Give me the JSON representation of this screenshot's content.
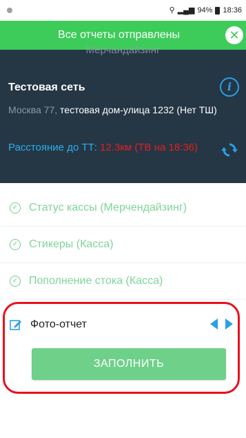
{
  "status_bar": {
    "battery": "94%",
    "time": "18:36"
  },
  "toast": {
    "message": "Все отчеты отправлены"
  },
  "info_panel": {
    "subtitle": "Мерчандайзинг",
    "store_name": "Тестовая сеть",
    "address_city": "Москва 77,",
    "address_rest": " тестовая дом-улица 1232 (Нет ТШ)",
    "distance_label": "Расстояние до ТТ: ",
    "distance_value": "12.3км (ТВ на 18:36)"
  },
  "tasks": [
    {
      "label": "Статус кассы (Мерчендайзинг)"
    },
    {
      "label": "Стикеры (Касса)"
    },
    {
      "label": "Пополнение стока (Касса)"
    }
  ],
  "photo_report": {
    "label": "Фото-отчет",
    "button_label": "ЗАПОЛНИТЬ"
  },
  "colors": {
    "toast_green": "#3dcc5a",
    "panel_dark": "#253644",
    "accent_blue": "#2aa1e6",
    "task_green": "#7fd49a",
    "highlight_red": "#e8101c"
  }
}
